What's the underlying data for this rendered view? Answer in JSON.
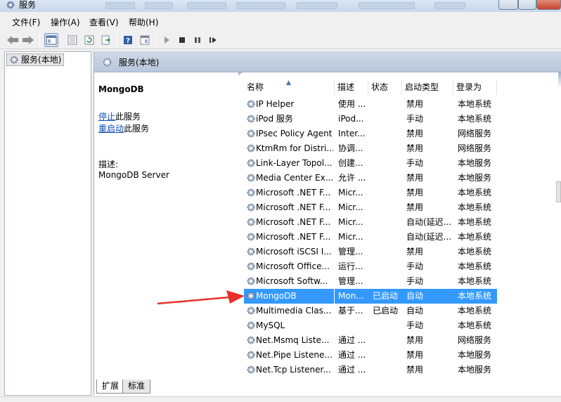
{
  "window": {
    "title": "服务"
  },
  "menu": [
    "文件(F)",
    "操作(A)",
    "查看(V)",
    "帮助(H)"
  ],
  "tree": {
    "root_label": "服务(本地)"
  },
  "panel": {
    "header_title": "服务(本地)"
  },
  "detail": {
    "name": "MongoDB",
    "stop_link": "停止",
    "stop_suffix": "此服务",
    "restart_link": "重启动",
    "restart_suffix": "此服务",
    "desc_label": "描述:",
    "desc_value": "MongoDB Server"
  },
  "columns": [
    "名称",
    "描述",
    "状态",
    "启动类型",
    "登录为"
  ],
  "rows": [
    {
      "name": "IP Helper",
      "desc": "使用 ...",
      "status": "",
      "startup": "禁用",
      "logon": "本地系统"
    },
    {
      "name": "iPod 服务",
      "desc": "iPod...",
      "status": "",
      "startup": "手动",
      "logon": "本地系统"
    },
    {
      "name": "IPsec Policy Agent",
      "desc": "Inter...",
      "status": "",
      "startup": "禁用",
      "logon": "网络服务"
    },
    {
      "name": "KtmRm for Distri...",
      "desc": "协调...",
      "status": "",
      "startup": "禁用",
      "logon": "网络服务"
    },
    {
      "name": "Link-Layer Topol...",
      "desc": "创建...",
      "status": "",
      "startup": "手动",
      "logon": "本地服务"
    },
    {
      "name": "Media Center Ex...",
      "desc": "允许 ...",
      "status": "",
      "startup": "禁用",
      "logon": "本地服务"
    },
    {
      "name": "Microsoft .NET F...",
      "desc": "Micr...",
      "status": "",
      "startup": "禁用",
      "logon": "本地系统"
    },
    {
      "name": "Microsoft .NET F...",
      "desc": "Micr...",
      "status": "",
      "startup": "禁用",
      "logon": "本地系统"
    },
    {
      "name": "Microsoft .NET F...",
      "desc": "Micr...",
      "status": "",
      "startup": "自动(延迟...",
      "logon": "本地系统"
    },
    {
      "name": "Microsoft .NET F...",
      "desc": "Micr...",
      "status": "",
      "startup": "自动(延迟...",
      "logon": "本地系统"
    },
    {
      "name": "Microsoft iSCSI I...",
      "desc": "管理...",
      "status": "",
      "startup": "禁用",
      "logon": "本地系统"
    },
    {
      "name": "Microsoft Office...",
      "desc": "运行...",
      "status": "",
      "startup": "手动",
      "logon": "本地系统"
    },
    {
      "name": "Microsoft Softw...",
      "desc": "管理...",
      "status": "",
      "startup": "手动",
      "logon": "本地系统"
    },
    {
      "name": "MongoDB",
      "desc": "Mon...",
      "status": "已启动",
      "startup": "自动",
      "logon": "本地系统"
    },
    {
      "name": "Multimedia Clas...",
      "desc": "基于...",
      "status": "已启动",
      "startup": "自动",
      "logon": "本地系统"
    },
    {
      "name": "MySQL",
      "desc": "",
      "status": "",
      "startup": "手动",
      "logon": "本地系统"
    },
    {
      "name": "Net.Msmq Liste...",
      "desc": "通过 ...",
      "status": "",
      "startup": "禁用",
      "logon": "网络服务"
    },
    {
      "name": "Net.Pipe Listene...",
      "desc": "通过 ...",
      "status": "",
      "startup": "禁用",
      "logon": "本地服务"
    },
    {
      "name": "Net.Tcp Listener...",
      "desc": "通过 ...",
      "status": "",
      "startup": "禁用",
      "logon": "本地服务"
    }
  ],
  "tabs": [
    "扩展",
    "标准"
  ],
  "colors": {
    "selection": "#3399ff",
    "link": "#0b4cb5",
    "arrow": "#e8322a"
  },
  "icons": {
    "service": "gear-icon",
    "back": "back-arrow-icon",
    "forward": "forward-arrow-icon",
    "play": "play-icon",
    "stop": "stop-icon",
    "pause": "pause-icon",
    "restart": "restart-icon",
    "help": "help-icon"
  }
}
